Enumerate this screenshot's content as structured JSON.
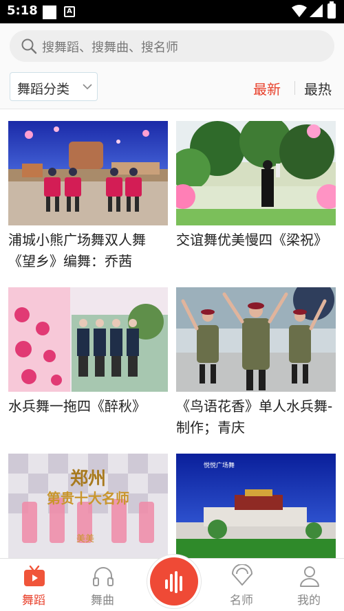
{
  "status_bar": {
    "time": "5:18",
    "badge": "A"
  },
  "search": {
    "placeholder": "搜舞蹈、搜舞曲、搜名师"
  },
  "filter": {
    "category_label": "舞蹈分类",
    "sort_new": "最新",
    "sort_hot": "最热"
  },
  "colors": {
    "accent": "#e8412c",
    "inactive": "#888888"
  },
  "videos": [
    {
      "title": "浦城小熊广场舞双人舞《望乡》编舞：乔茜"
    },
    {
      "title": "交谊舞优美慢四《梁祝》"
    },
    {
      "title": "水兵舞一拖四《醉秋》"
    },
    {
      "title": "《鸟语花香》单人水兵舞-制作；青庆"
    },
    {
      "title": ""
    },
    {
      "title": ""
    }
  ],
  "thumb_text": {
    "v5_main": "郑州",
    "v5_sub": "第贵十大名师",
    "v5_small": "美美",
    "v6_small": "悦悦广场舞"
  },
  "bottom_nav": {
    "items": [
      {
        "label": "舞蹈",
        "icon": "tv-icon",
        "active": true
      },
      {
        "label": "舞曲",
        "icon": "headphones-icon",
        "active": false
      },
      {
        "label": "",
        "icon": "sound-bars-icon",
        "active": false
      },
      {
        "label": "名师",
        "icon": "fan-icon",
        "active": false
      },
      {
        "label": "我的",
        "icon": "person-icon",
        "active": false
      }
    ]
  }
}
